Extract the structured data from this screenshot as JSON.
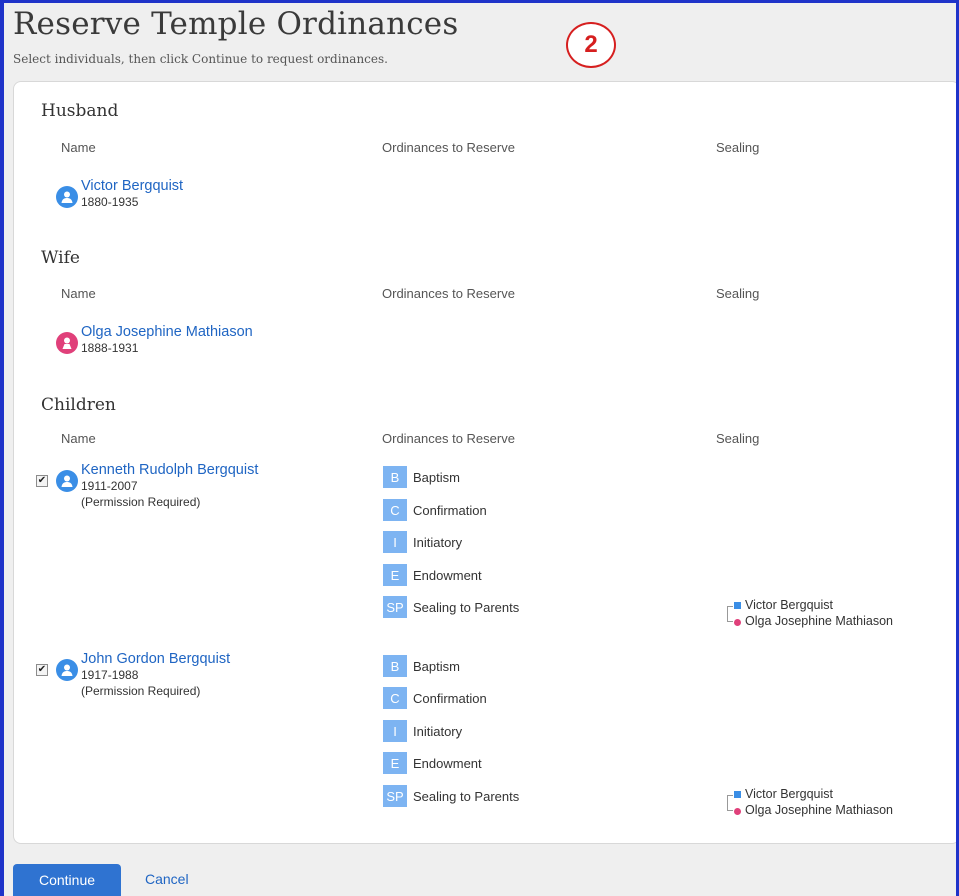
{
  "header": {
    "title": "Reserve Temple Ordinances",
    "subtitle": "Select individuals, then click Continue to request ordinances.",
    "step_badge": "2"
  },
  "columns": {
    "name": "Name",
    "ordinances": "Ordinances to Reserve",
    "sealing": "Sealing"
  },
  "husband": {
    "section_title": "Husband",
    "name": "Victor Bergquist",
    "dates": "1880-1935"
  },
  "wife": {
    "section_title": "Wife",
    "name": "Olga Josephine Mathiason",
    "dates": "1888-1931"
  },
  "children": {
    "section_title": "Children",
    "list": [
      {
        "name": "Kenneth Rudolph Bergquist",
        "dates": "1911-2007",
        "note": "(Permission Required)",
        "checked": true,
        "ordinances": [
          {
            "code": "B",
            "label": "Baptism"
          },
          {
            "code": "C",
            "label": "Confirmation"
          },
          {
            "code": "I",
            "label": "Initiatory"
          },
          {
            "code": "E",
            "label": "Endowment"
          },
          {
            "code": "SP",
            "label": "Sealing to Parents"
          }
        ],
        "sealing": {
          "father": "Victor Bergquist",
          "mother": "Olga Josephine Mathiason"
        }
      },
      {
        "name": "John Gordon Bergquist",
        "dates": "1917-1988",
        "note": "(Permission Required)",
        "checked": true,
        "ordinances": [
          {
            "code": "B",
            "label": "Baptism"
          },
          {
            "code": "C",
            "label": "Confirmation"
          },
          {
            "code": "I",
            "label": "Initiatory"
          },
          {
            "code": "E",
            "label": "Endowment"
          },
          {
            "code": "SP",
            "label": "Sealing to Parents"
          }
        ],
        "sealing": {
          "father": "Victor Bergquist",
          "mother": "Olga Josephine Mathiason"
        }
      }
    ]
  },
  "actions": {
    "continue_label": "Continue",
    "cancel_label": "Cancel"
  },
  "colors": {
    "male": "#3a8ee6",
    "female": "#e0407a",
    "ordinance_tag": "#7db4f2",
    "link": "#1f65c3",
    "primary_button": "#2f73d1",
    "step_badge": "#d61f1f"
  }
}
